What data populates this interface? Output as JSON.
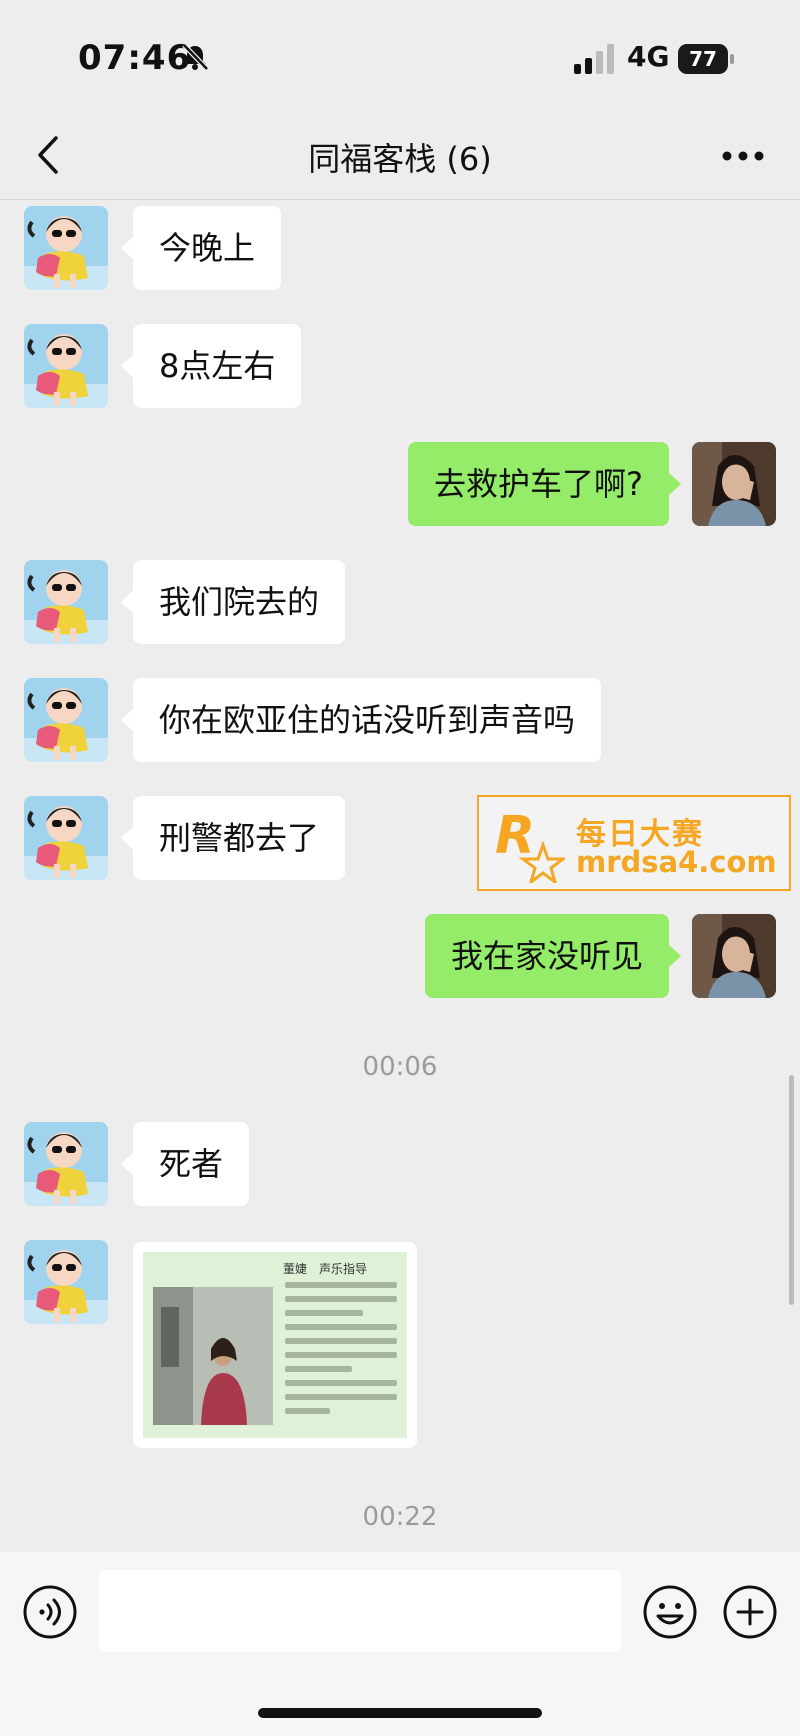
{
  "status_bar": {
    "time": "07:46",
    "network": "4G",
    "battery": "77",
    "icons": [
      "bell-off-icon",
      "signal-icon",
      "battery-icon"
    ]
  },
  "nav": {
    "title": "同福客栈 (6)",
    "back_icon": "chevron-left-icon",
    "more_icon": "more-horizontal-icon"
  },
  "messages": [
    {
      "side": "in",
      "text": "今晚上"
    },
    {
      "side": "in",
      "text": "8点左右"
    },
    {
      "side": "out",
      "text": "去救护车了啊?"
    },
    {
      "side": "in",
      "text": "我们院去的"
    },
    {
      "side": "in",
      "text": "你在欧亚住的话没听到声音吗"
    },
    {
      "side": "in",
      "text": "刑警都去了"
    },
    {
      "side": "out",
      "text": "我在家没听见"
    },
    {
      "side": "in",
      "text": "死者"
    },
    {
      "side": "in",
      "type": "image",
      "image_title": "董婕　声乐指导"
    }
  ],
  "timestamps": [
    "00:06",
    "00:22"
  ],
  "watermark": {
    "brand": "每日大赛",
    "url": "mrdsa4.com",
    "color": "#f5a623"
  },
  "input_bar": {
    "placeholder": "",
    "icons": [
      "voice-icon",
      "emoji-icon",
      "plus-icon"
    ]
  },
  "colors": {
    "background": "#ededed",
    "outgoing_bubble": "#95ec69",
    "incoming_bubble": "#ffffff"
  }
}
